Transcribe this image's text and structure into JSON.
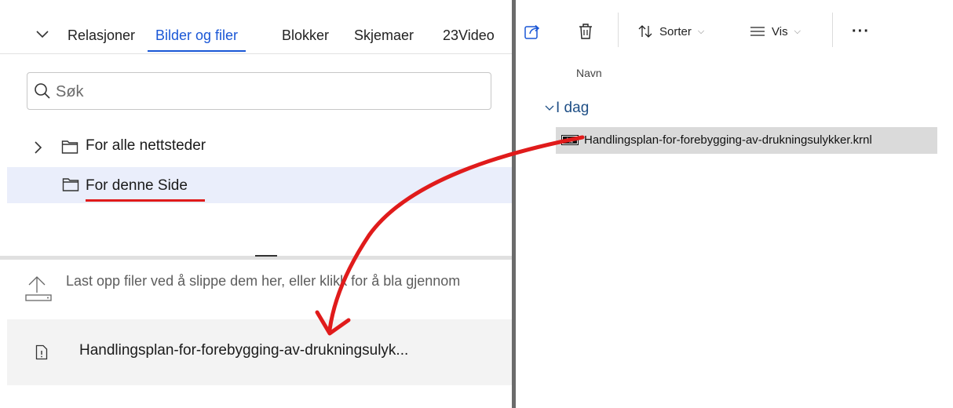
{
  "left_panel": {
    "tabs": [
      {
        "label": "Relasjoner"
      },
      {
        "label": "Bilder og filer"
      },
      {
        "label": "Blokker"
      },
      {
        "label": "Skjemaer"
      },
      {
        "label": "23Video"
      }
    ],
    "active_tab": "Bilder og filer",
    "search": {
      "placeholder": "Søk"
    },
    "tree": [
      {
        "label": "For alle nettsteder",
        "expandable": true
      },
      {
        "label": "For denne Side",
        "selected": true
      }
    ],
    "upload_hint": "Last opp filer ved å slippe dem her, eller klikk for å bla gjennom",
    "uploaded_file": "Handlingsplan-for-forebygging-av-drukningsulyk..."
  },
  "right_panel": {
    "toolbar": {
      "share_icon": "share-icon",
      "delete_icon": "trash-icon",
      "sort_label": "Sorter",
      "view_label": "Vis",
      "more_label": "···"
    },
    "column_header": "Navn",
    "group_label": "I dag",
    "file_item": "Handlingsplan-for-forebygging-av-drukningsulykker.krnl"
  },
  "colors": {
    "accent": "#1a57d6",
    "annotation": "#e01b1b",
    "selected_row": "#eaeefb",
    "group_text": "#1f4f86"
  }
}
